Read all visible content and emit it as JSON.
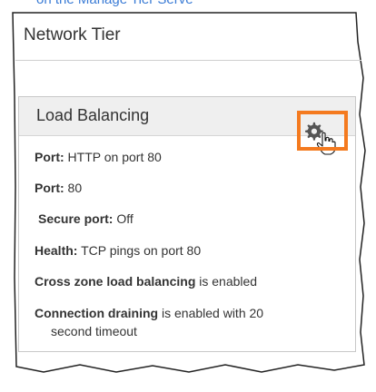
{
  "top_text": "on the Manage Tier Serve",
  "tier": {
    "title": "Network Tier"
  },
  "load_balancing": {
    "title": "Load Balancing",
    "settings_icon": "gear-icon",
    "cursor_icon": "hand-pointer-icon",
    "rows": [
      {
        "label": "Port:",
        "value": " HTTP on port 80"
      },
      {
        "label": "Port:",
        "value": " 80"
      },
      {
        "label": "Secure port:",
        "value": " Off"
      },
      {
        "label": "Health:",
        "value": " TCP pings on port 80"
      },
      {
        "label": "Cross zone load balancing",
        "value": " is enabled"
      },
      {
        "label": "Connection draining",
        "value": " is enabled with 20",
        "value2": "second timeout"
      }
    ]
  },
  "colors": {
    "highlight": "#f47a1f",
    "header_bg": "#efefef",
    "link": "#3a7bd5"
  }
}
